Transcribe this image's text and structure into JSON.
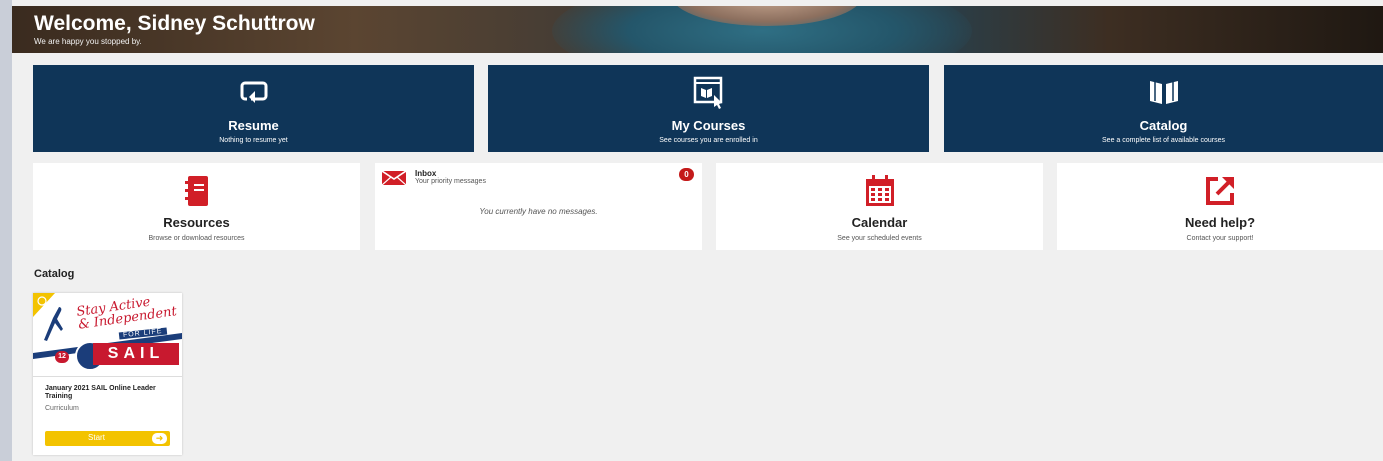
{
  "header": {
    "title": "Welcome, Sidney Schuttrow",
    "subtitle": "We are happy you stopped by."
  },
  "tiles_top": [
    {
      "title": "Resume",
      "subtitle": "Nothing to resume yet",
      "icon": "resume-icon"
    },
    {
      "title": "My Courses",
      "subtitle": "See courses you are enrolled in",
      "icon": "my-courses-icon"
    },
    {
      "title": "Catalog",
      "subtitle": "See a complete list of available courses",
      "icon": "catalog-book-icon"
    }
  ],
  "tiles_bottom": {
    "resources": {
      "title": "Resources",
      "subtitle": "Browse or download resources",
      "icon": "resources-notebook-icon"
    },
    "inbox": {
      "title": "Inbox",
      "subtitle": "Your priority messages",
      "count": "0",
      "empty": "You currently have no messages.",
      "icon": "envelope-icon"
    },
    "calendar": {
      "title": "Calendar",
      "subtitle": "See your scheduled events",
      "icon": "calendar-icon"
    },
    "help": {
      "title": "Need help?",
      "subtitle": "Contact your support!",
      "icon": "external-link-icon"
    }
  },
  "catalog": {
    "heading": "Catalog",
    "items": [
      {
        "title": "January 2021 SAIL Online Leader Training",
        "type": "Curriculum",
        "button": "Start",
        "thumbnail_text": {
          "line1": "Stay Active",
          "line2": "& Independent",
          "life": "FOR LIFE",
          "brand": "SAIL",
          "number": "12"
        }
      }
    ]
  },
  "colors": {
    "tile_blue": "#0f3558",
    "accent_red": "#c41a1a",
    "start_yellow": "#f3c300",
    "background": "#f0f0f0"
  }
}
